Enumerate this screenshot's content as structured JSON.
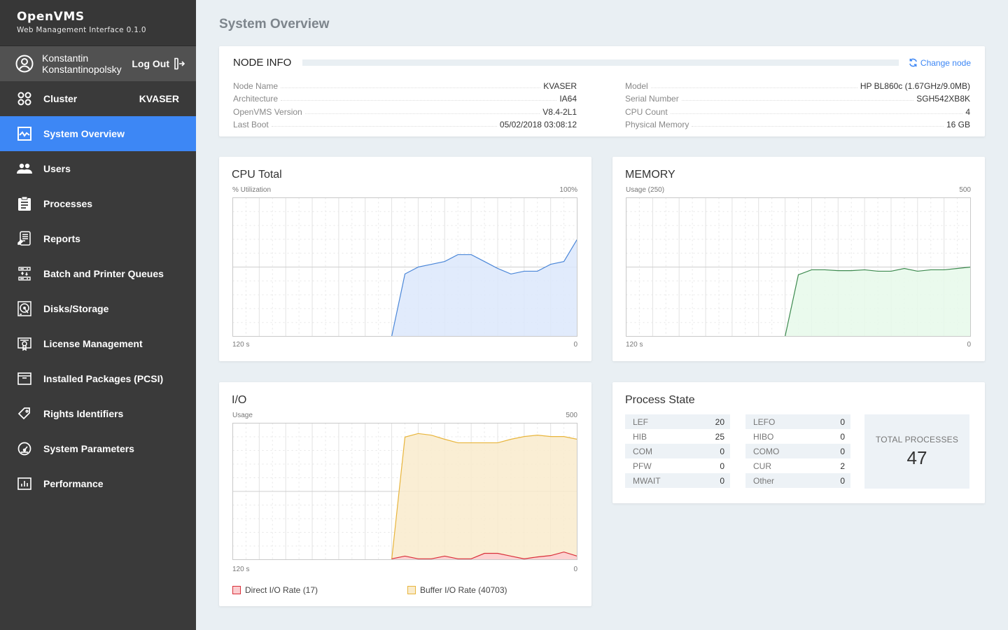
{
  "app": {
    "title": "OpenVMS",
    "subtitle": "Web Management Interface 0.1.0"
  },
  "user": {
    "first_name": "Konstantin",
    "last_name": "Konstantinopolsky",
    "logout_label": "Log Out"
  },
  "sidebar": {
    "items": [
      {
        "label": "Cluster",
        "extra": "KVASER",
        "icon": "cluster-icon"
      },
      {
        "label": "System Overview",
        "icon": "activity-chart-icon",
        "active": true
      },
      {
        "label": "Users",
        "icon": "users-icon"
      },
      {
        "label": "Processes",
        "icon": "clipboard-icon"
      },
      {
        "label": "Reports",
        "icon": "report-icon"
      },
      {
        "label": "Batch and Printer Queues",
        "icon": "queue-icon"
      },
      {
        "label": "Disks/Storage",
        "icon": "disk-icon"
      },
      {
        "label": "License Management",
        "icon": "certificate-icon"
      },
      {
        "label": "Installed Packages (PCSI)",
        "icon": "package-icon"
      },
      {
        "label": "Rights Identifiers",
        "icon": "tag-icon"
      },
      {
        "label": "System Parameters",
        "icon": "gauge-icon"
      },
      {
        "label": "Performance",
        "icon": "bar-chart-icon"
      }
    ]
  },
  "page": {
    "title": "System Overview"
  },
  "node_info": {
    "title": "NODE INFO",
    "change_node_label": "Change node",
    "left": [
      {
        "key": "Node Name",
        "value": "KVASER"
      },
      {
        "key": "Architecture",
        "value": "IA64"
      },
      {
        "key": "OpenVMS Version",
        "value": "V8.4-2L1"
      },
      {
        "key": "Last Boot",
        "value": "05/02/2018 03:08:12"
      }
    ],
    "right": [
      {
        "key": "Model",
        "value": "HP BL860c  (1.67GHz/9.0MB)"
      },
      {
        "key": "Serial Number",
        "value": "SGH542XB8K"
      },
      {
        "key": "CPU Count",
        "value": "4"
      },
      {
        "key": "Physical Memory",
        "value": "16 GB"
      }
    ]
  },
  "chart_data": [
    {
      "id": "cpu",
      "type": "area",
      "title": "CPU Total",
      "ylabel": "% Utilization",
      "ymax_label": "100%",
      "x_start_label": "120 s",
      "x_end_label": "0",
      "ylim": [
        0,
        100
      ],
      "xlim": [
        120,
        0
      ],
      "grid": true,
      "colors": {
        "line": "#4a86d8",
        "fill": "#dce8fb"
      },
      "series": [
        {
          "name": "CPU",
          "values": [
            null,
            null,
            null,
            null,
            null,
            null,
            null,
            null,
            null,
            null,
            null,
            null,
            0,
            45,
            50,
            52,
            54,
            59,
            59,
            54,
            49,
            45,
            47,
            47,
            52,
            54,
            70
          ]
        }
      ]
    },
    {
      "id": "memory",
      "type": "area",
      "title": "MEMORY",
      "ylabel": "Usage (250)",
      "ymax_label": "500",
      "x_start_label": "120 s",
      "x_end_label": "0",
      "ylim": [
        0,
        500
      ],
      "xlim": [
        120,
        0
      ],
      "grid": true,
      "colors": {
        "line": "#3d8a4f",
        "fill": "#e6f9ea"
      },
      "series": [
        {
          "name": "Memory",
          "values": [
            null,
            null,
            null,
            null,
            null,
            null,
            null,
            null,
            null,
            null,
            null,
            null,
            0,
            222,
            240,
            240,
            237,
            237,
            240,
            235,
            235,
            245,
            235,
            240,
            240,
            245,
            250
          ]
        }
      ]
    },
    {
      "id": "io",
      "type": "area",
      "title": "I/O",
      "ylabel": "Usage",
      "ymax_label": "500",
      "x_start_label": "120 s",
      "x_end_label": "0",
      "ylim": [
        0,
        500
      ],
      "xlim": [
        120,
        0
      ],
      "grid": true,
      "legend": "bottom",
      "series": [
        {
          "name": "Buffer I/O Rate (40703)",
          "color": "#e8b53c",
          "fill": "#f9ebcc",
          "values": [
            null,
            null,
            null,
            null,
            null,
            null,
            null,
            null,
            null,
            null,
            null,
            null,
            0,
            449,
            462,
            456,
            441,
            428,
            428,
            428,
            428,
            441,
            451,
            456,
            451,
            451,
            441
          ]
        },
        {
          "name": "Direct I/O Rate (17)",
          "color": "#d9303a",
          "fill": "#fbcdd0",
          "values": [
            null,
            null,
            null,
            null,
            null,
            null,
            null,
            null,
            null,
            null,
            null,
            null,
            3,
            13,
            3,
            3,
            13,
            3,
            3,
            23,
            23,
            13,
            3,
            10,
            15,
            28,
            13
          ]
        }
      ]
    }
  ],
  "process_state": {
    "title": "Process State",
    "left": [
      {
        "key": "LEF",
        "value": "20"
      },
      {
        "key": "HIB",
        "value": "25"
      },
      {
        "key": "COM",
        "value": "0"
      },
      {
        "key": "PFW",
        "value": "0"
      },
      {
        "key": "MWAIT",
        "value": "0"
      }
    ],
    "right": [
      {
        "key": "LEFO",
        "value": "0"
      },
      {
        "key": "HIBO",
        "value": "0"
      },
      {
        "key": "COMO",
        "value": "0"
      },
      {
        "key": "CUR",
        "value": "2"
      },
      {
        "key": "Other",
        "value": "0"
      }
    ],
    "total_label": "TOTAL PROCESSES",
    "total_value": "47"
  },
  "theme": {
    "accent": "#3d87f5",
    "sidebar_bg": "#3a3a3a",
    "page_bg": "#e9eff3"
  }
}
